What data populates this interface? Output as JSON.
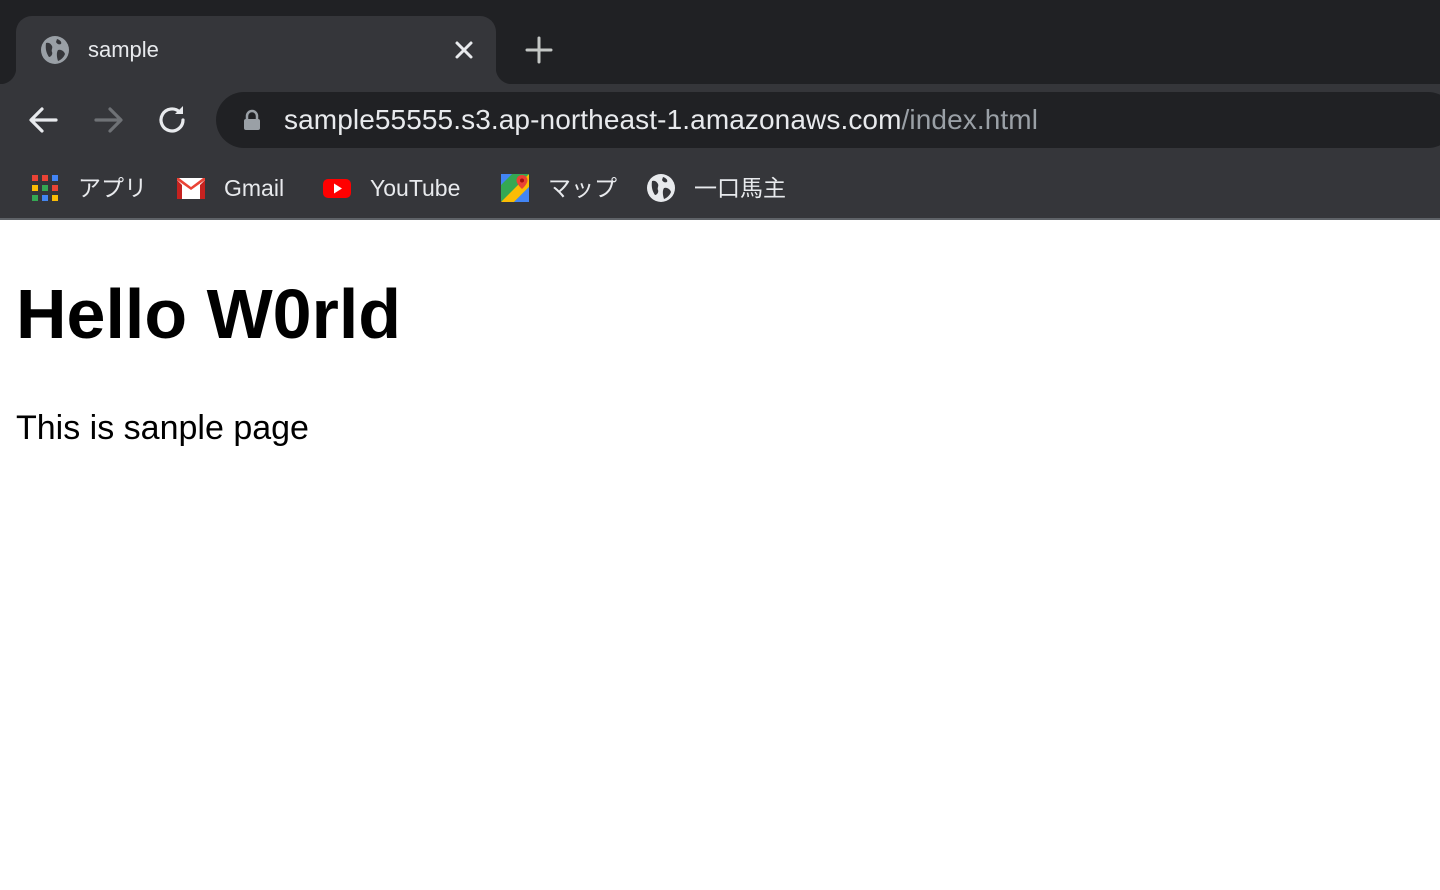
{
  "tab": {
    "title": "sample",
    "icon": "globe-icon"
  },
  "toolbar": {
    "url_host": "sample55555.s3.ap-northeast-1.amazonaws.com",
    "url_path": "/index.html"
  },
  "bookmarks": [
    {
      "label": "アプリ",
      "icon": "apps-grid-icon"
    },
    {
      "label": "Gmail",
      "icon": "gmail-icon"
    },
    {
      "label": "YouTube",
      "icon": "youtube-icon"
    },
    {
      "label": "マップ",
      "icon": "maps-icon"
    },
    {
      "label": "一口馬主",
      "icon": "globe-icon"
    }
  ],
  "page": {
    "heading": "Hello W0rld",
    "paragraph": "This is sanple page"
  },
  "colors": {
    "tabstrip_bg": "#202124",
    "toolbar_bg": "#35363a",
    "text_light": "#e8eaed",
    "text_dim": "#9aa0a6"
  }
}
